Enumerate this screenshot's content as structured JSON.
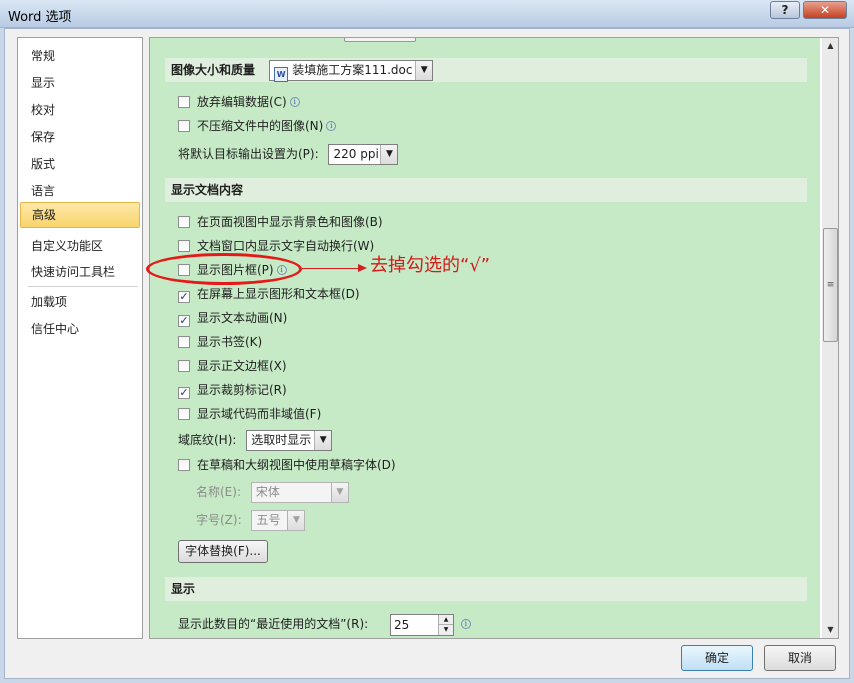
{
  "window": {
    "title": "Word 选项",
    "help_label": "?",
    "close_label": "✕"
  },
  "nav": {
    "items": [
      {
        "label": "常规"
      },
      {
        "label": "显示"
      },
      {
        "label": "校对"
      },
      {
        "label": "保存"
      },
      {
        "label": "版式"
      },
      {
        "label": "语言"
      },
      {
        "label": "高级",
        "active": true
      },
      {
        "label": "自定义功能区"
      },
      {
        "label": "快速访问工具栏"
      },
      {
        "label": "加载项"
      },
      {
        "label": "信任中心"
      }
    ]
  },
  "image_section": {
    "title": "图像大小和质量",
    "document": "装填施工方案111.doc",
    "doc_icon_text": "W",
    "discard_edit_label": "放弃编辑数据(C)",
    "no_compress_label": "不压缩文件中的图像(N)",
    "default_output_label": "将默认目标输出设置为(P):",
    "default_output_value": "220 ppi"
  },
  "doc_content_section": {
    "title": "显示文档内容",
    "options": [
      {
        "label": "在页面视图中显示背景色和图像(B)",
        "checked": false
      },
      {
        "label": "文档窗口内显示文字自动换行(W)",
        "checked": false
      },
      {
        "label": "显示图片框(P)",
        "checked": false,
        "info": true
      },
      {
        "label": "在屏幕上显示图形和文本框(D)",
        "checked": true
      },
      {
        "label": "显示文本动画(N)",
        "checked": true
      },
      {
        "label": "显示书签(K)",
        "checked": false
      },
      {
        "label": "显示正文边框(X)",
        "checked": false
      },
      {
        "label": "显示裁剪标记(R)",
        "checked": true
      },
      {
        "label": "显示域代码而非域值(F)",
        "checked": false
      }
    ],
    "field_shading_label": "域底纹(H):",
    "field_shading_value": "选取时显示",
    "draft_font_label": "在草稿和大纲视图中使用草稿字体(D)",
    "font_name_label": "名称(E):",
    "font_name_value": "宋体",
    "font_size_label": "字号(Z):",
    "font_size_value": "五号",
    "font_substitution_label": "字体替换(F)..."
  },
  "display_section": {
    "title": "显示",
    "recent_docs_label": "显示此数目的“最近使用的文档”(R):",
    "recent_docs_value": "25"
  },
  "annotation": {
    "text": "去掉勾选的“√”",
    "color": "#e61919"
  },
  "footer": {
    "ok_label": "确定",
    "cancel_label": "取消"
  },
  "colors": {
    "content_bg": "#c6e9c6",
    "section_bg": "#dfeedd",
    "nav_active": "#f8d46c"
  }
}
